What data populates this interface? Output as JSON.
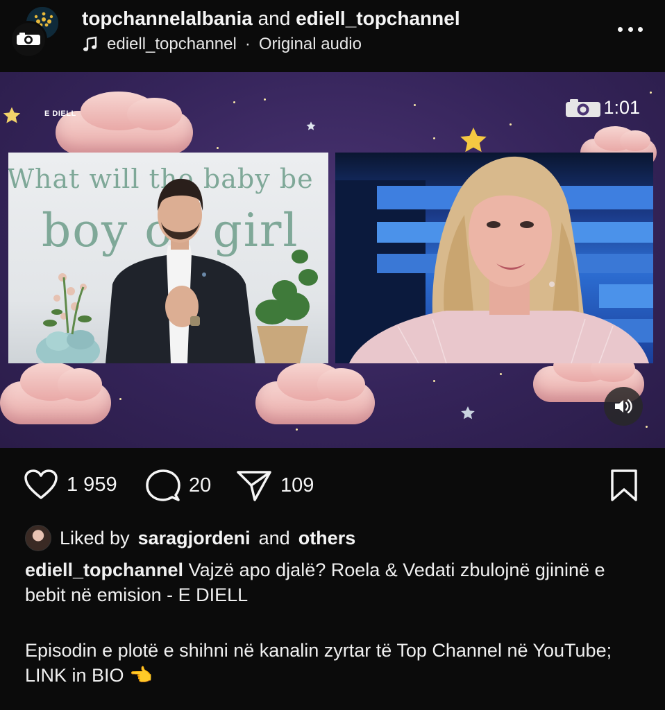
{
  "header": {
    "account_primary": "topchannelalbania",
    "and_text": "and",
    "account_secondary": "ediell_topchannel",
    "audio_account": "ediell_topchannel",
    "audio_separator": "·",
    "audio_label": "Original audio",
    "more_icon": "more-horizontal-icon"
  },
  "video": {
    "brand_tag": "E DIELL",
    "timestamp": "1:01",
    "backdrop_line1": "What  will  the  baby  be",
    "backdrop_line2": "boy  or  girl",
    "sound_icon": "speaker-icon"
  },
  "actions": {
    "likes": "1 959",
    "comments": "20",
    "shares": "109"
  },
  "liked_by": {
    "prefix": "Liked by",
    "user": "saragjordeni",
    "and_text": "and",
    "others": "others"
  },
  "caption": {
    "author": "ediell_topchannel",
    "text": "Vajzë apo djalë? Roela & Vedati zbulojnë gjininë e bebit në emision - E DIELL",
    "text2": "Episodin e plotë e shihni në kanalin zyrtar të Top Channel në YouTube; LINK in BIO 👈"
  },
  "colors": {
    "background": "#0b0b0b",
    "video_bg": "#35245a",
    "text": "#f5f5f5"
  }
}
